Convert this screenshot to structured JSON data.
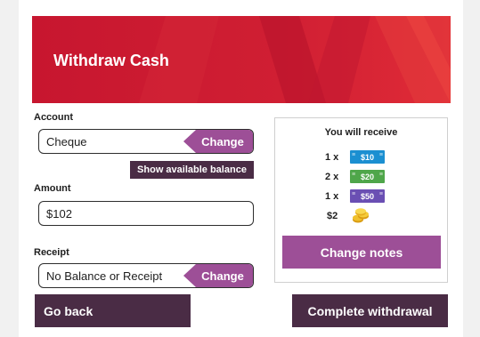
{
  "page": {
    "title": "Withdraw Cash"
  },
  "account": {
    "label": "Account",
    "value": "Cheque",
    "change_label": "Change",
    "show_balance_label": "Show available balance"
  },
  "amount": {
    "label": "Amount",
    "value": "$102"
  },
  "receipt": {
    "label": "Receipt",
    "value": "No Balance or Receipt",
    "change_label": "Change"
  },
  "receive": {
    "title": "You will receive",
    "rows": [
      {
        "qty": "1 x",
        "note": "$10",
        "color": "#1b8fd1",
        "icon": "banknote-icon"
      },
      {
        "qty": "2 x",
        "note": "$20",
        "color": "#4fa64a",
        "icon": "banknote-icon"
      },
      {
        "qty": "1 x",
        "note": "$50",
        "color": "#6a4fb3",
        "icon": "banknote-icon"
      },
      {
        "qty": "$2",
        "icon": "coins-icon",
        "color": "#e5b020"
      }
    ],
    "change_notes_label": "Change notes"
  },
  "footer": {
    "back_label": "Go back",
    "complete_label": "Complete withdrawal"
  },
  "colors": {
    "brand_red": "#c7162f",
    "accent_purple": "#9d4f97",
    "dark_plum": "#4a2c45"
  }
}
